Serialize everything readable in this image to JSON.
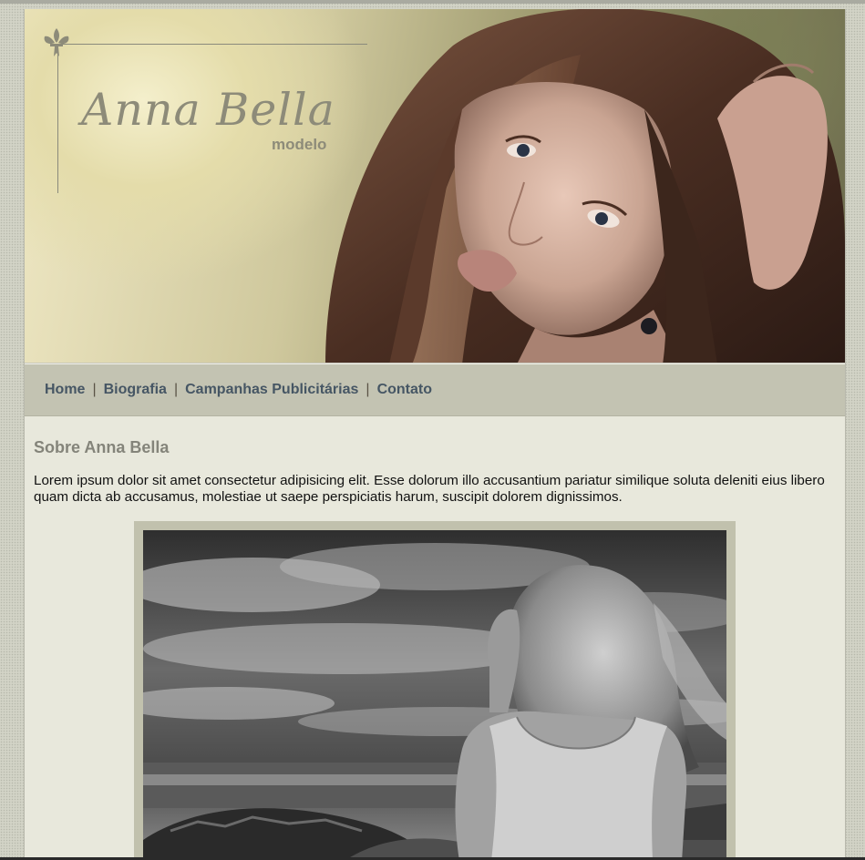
{
  "brand": {
    "name": "Anna Bella",
    "tagline": "modelo"
  },
  "nav": {
    "items": [
      {
        "label": "Home"
      },
      {
        "label": "Biografia"
      },
      {
        "label": "Campanhas Publicitárias"
      },
      {
        "label": "Contato"
      }
    ],
    "separator": "|"
  },
  "content": {
    "title": "Sobre Anna Bella",
    "intro": "Lorem ipsum dolor sit amet consectetur adipisicing elit. Esse dolorum illo accusantium pariatur similique soluta deleniti eius libero quam dicta ab accusamus, molestiae ut saepe perspiciatis harum, suscipit dolorem dignissimos."
  },
  "colors": {
    "nav_bg": "#c3c3b2",
    "content_bg": "#e8e8dc",
    "nav_link": "#465664",
    "title": "#84847a",
    "brand": "#8d8b79"
  },
  "icons": {
    "logo_ornament": "fleur-de-lis-icon"
  }
}
